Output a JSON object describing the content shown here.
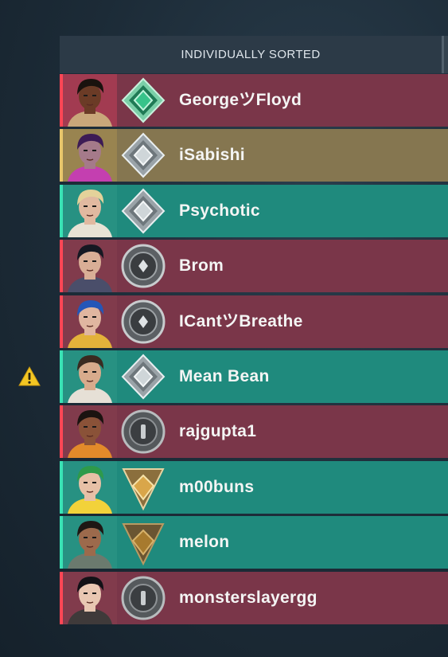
{
  "header": {
    "title": "INDIVIDUALLY SORTED"
  },
  "players": [
    {
      "name": "GeorgeツFloyd",
      "team": "enemy",
      "agent_icon": "agent-portrait-dark-skin-icon",
      "rank_icon": "diamond-rank-icon"
    },
    {
      "name": "iSabishi",
      "team": "self",
      "agent_icon": "agent-portrait-purple-hair-icon",
      "rank_icon": "platinum-rank-icon"
    },
    {
      "name": "Psychotic",
      "team": "ally",
      "agent_icon": "agent-portrait-blond-icon",
      "rank_icon": "platinum-rank-icon"
    },
    {
      "name": "Brom",
      "team": "enemy",
      "agent_icon": "agent-portrait-dark-hair-icon",
      "rank_icon": "silver-rank-icon"
    },
    {
      "name": "ICantツBreathe",
      "team": "enemy",
      "agent_icon": "agent-portrait-blue-hair-icon",
      "rank_icon": "silver-rank-icon"
    },
    {
      "name": "Mean Bean",
      "team": "ally",
      "agent_icon": "agent-portrait-glasses-icon",
      "rank_icon": "platinum-rank-icon"
    },
    {
      "name": "rajgupta1",
      "team": "enemy",
      "agent_icon": "agent-portrait-orange-icon",
      "rank_icon": "iron-rank-icon"
    },
    {
      "name": "m00buns",
      "team": "ally",
      "agent_icon": "agent-portrait-green-cap-icon",
      "rank_icon": "gold-rank-icon"
    },
    {
      "name": "melon",
      "team": "ally",
      "agent_icon": "agent-portrait-bearded-icon",
      "rank_icon": "bronze-rank-icon"
    },
    {
      "name": "monsterslayergg",
      "team": "enemy",
      "agent_icon": "agent-portrait-black-hair-icon",
      "rank_icon": "iron-rank-icon"
    }
  ],
  "warning_icon": "warning-icon",
  "colors": {
    "enemy": "#7a3649",
    "enemy_accent": "#ff4655",
    "ally": "#1f8a7d",
    "ally_accent": "#39e3b5",
    "self": "#857650",
    "self_accent": "#e8c66b"
  }
}
